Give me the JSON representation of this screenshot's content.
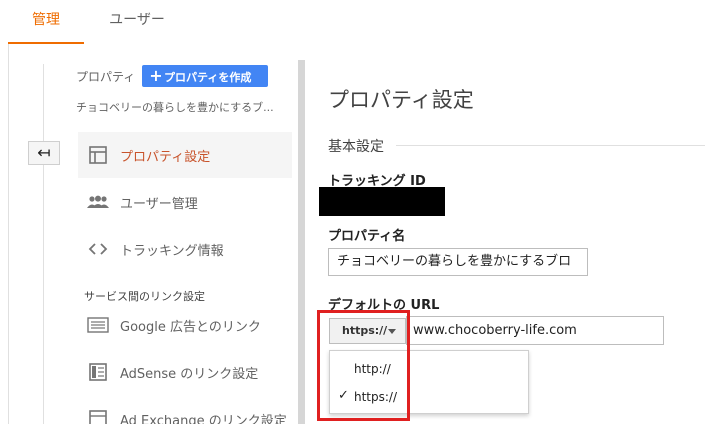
{
  "tabs": {
    "admin": "管理",
    "users": "ユーザー"
  },
  "sidebar": {
    "property_label": "プロパティ",
    "create_button": "プロパティを作成",
    "property_name": "チョコベリーの暮らしを豊かにするブ...",
    "items": [
      {
        "label": "プロパティ設定",
        "icon": "property-settings-icon",
        "active": true
      },
      {
        "label": "ユーザー管理",
        "icon": "user-management-icon"
      },
      {
        "label": "トラッキング情報",
        "icon": "code-icon"
      }
    ],
    "section_header": "サービス間のリンク設定",
    "link_items": [
      {
        "label": "Google 広告とのリンク",
        "icon": "google-ads-icon"
      },
      {
        "label": "AdSense のリンク設定",
        "icon": "adsense-icon"
      },
      {
        "label": "Ad Exchange のリンク設定",
        "icon": "ad-exchange-icon"
      }
    ]
  },
  "main": {
    "title": "プロパティ設定",
    "basic_settings": "基本設定",
    "tracking_id_label": "トラッキング ID",
    "property_name_label": "プロパティ名",
    "property_name_value": "チョコベリーの暮らしを豊かにするブロ",
    "default_url_label": "デフォルトの URL",
    "protocol_selected": "https://",
    "url_value": "www.chocoberry-life.com",
    "protocol_options": [
      {
        "label": "http://",
        "selected": false
      },
      {
        "label": "https://",
        "selected": true
      }
    ]
  },
  "colors": {
    "accent": "#ef6c00",
    "active_text": "#c8532b",
    "button": "#4285f4",
    "highlight": "#e02020"
  }
}
